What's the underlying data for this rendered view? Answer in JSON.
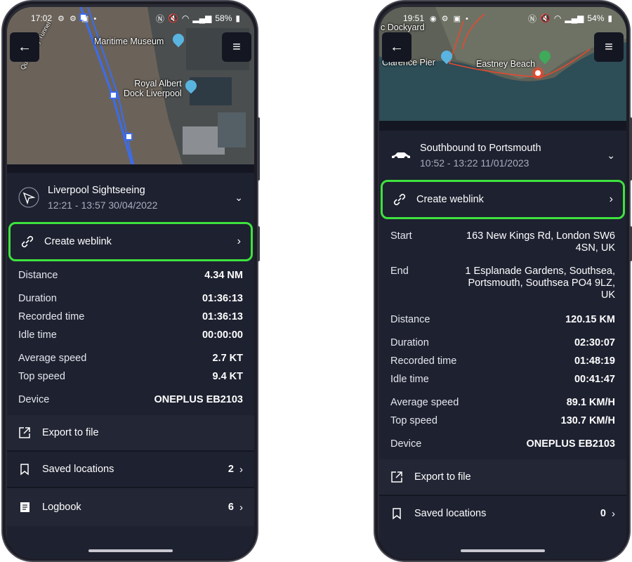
{
  "left_phone": {
    "status_bar": {
      "time": "17:02",
      "battery": "58%"
    },
    "map": {
      "labels": [
        "Maritime Museum",
        "Royal Albert\nDock Liverpool",
        "Queensway Tunnel"
      ]
    },
    "trip": {
      "title": "Liverpool Sightseeing",
      "time_range": "12:21 - 13:57 30/04/2022",
      "icon": "navigation-arrow-icon"
    },
    "weblink_label": "Create weblink",
    "stats": [
      {
        "label": "Distance",
        "value": "4.34 NM"
      },
      {
        "label": "Duration",
        "value": "01:36:13"
      },
      {
        "label": "Recorded time",
        "value": "01:36:13"
      },
      {
        "label": "Idle time",
        "value": "00:00:00"
      },
      {
        "label": "Average speed",
        "value": "2.7 KT"
      },
      {
        "label": "Top speed",
        "value": "9.4 KT"
      },
      {
        "label": "Device",
        "value": "ONEPLUS EB2103"
      }
    ],
    "actions": [
      {
        "label": "Export to file",
        "icon": "export-icon"
      },
      {
        "label": "Saved locations",
        "icon": "bookmark-icon",
        "count": "2"
      },
      {
        "label": "Logbook",
        "icon": "logbook-icon",
        "count": "6"
      }
    ]
  },
  "right_phone": {
    "status_bar": {
      "time": "19:51",
      "battery": "54%"
    },
    "map": {
      "labels": [
        "c Dockyard",
        "Clarence Pier",
        "Eastney Beach"
      ]
    },
    "trip": {
      "title": "Southbound to Portsmouth",
      "time_range": "10:52 - 13:22 11/01/2023",
      "icon": "car-icon"
    },
    "weblink_label": "Create weblink",
    "addresses": [
      {
        "label": "Start",
        "value": "163 New Kings Rd, London SW6 4SN, UK"
      },
      {
        "label": "End",
        "value": "1 Esplanade Gardens, Southsea, Portsmouth, Southsea PO4 9LZ, UK"
      }
    ],
    "stats": [
      {
        "label": "Distance",
        "value": "120.15 KM"
      },
      {
        "label": "Duration",
        "value": "02:30:07"
      },
      {
        "label": "Recorded time",
        "value": "01:48:19"
      },
      {
        "label": "Idle time",
        "value": "00:41:47"
      },
      {
        "label": "Average speed",
        "value": "89.1 KM/H"
      },
      {
        "label": "Top speed",
        "value": "130.7 KM/H"
      },
      {
        "label": "Device",
        "value": "ONEPLUS EB2103"
      }
    ],
    "actions": [
      {
        "label": "Export to file",
        "icon": "export-icon"
      },
      {
        "label": "Saved locations",
        "icon": "bookmark-icon",
        "count": "0"
      }
    ]
  },
  "colors": {
    "highlight": "#3ee23e",
    "panel": "#1e2130",
    "route_blue": "#3b6cf0",
    "route_red": "#e8482e"
  }
}
